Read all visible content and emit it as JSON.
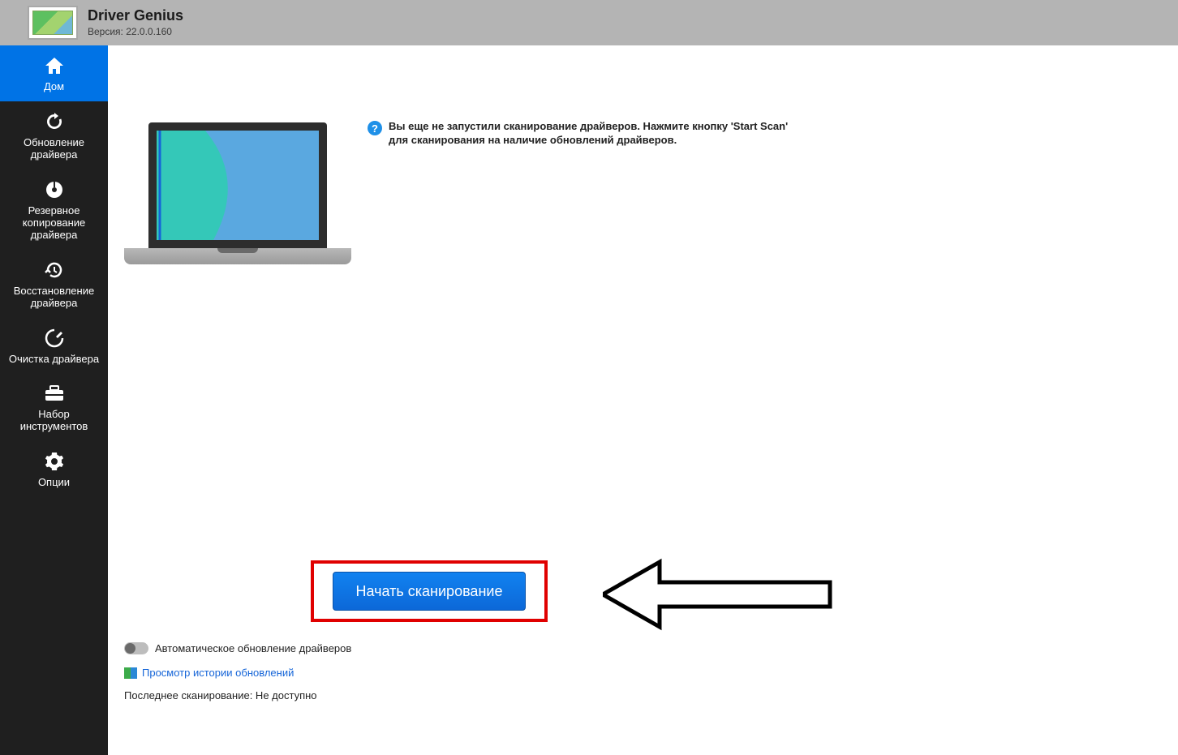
{
  "header": {
    "title": "Driver Genius",
    "version": "Версия: 22.0.0.160"
  },
  "sidebar": [
    {
      "label": "Дом",
      "icon": "home",
      "active": true
    },
    {
      "label": "Обновление драйвера",
      "icon": "refresh",
      "active": false
    },
    {
      "label": "Резервное копирование драйвера",
      "icon": "disc",
      "active": false
    },
    {
      "label": "Восстановление драйвера",
      "icon": "restore",
      "active": false
    },
    {
      "label": "Очистка драйвера",
      "icon": "clean",
      "active": false
    },
    {
      "label": "Набор инструментов",
      "icon": "toolbox",
      "active": false
    },
    {
      "label": "Опции",
      "icon": "gear",
      "active": false
    }
  ],
  "info_text": "Вы еще не запустили сканирование драйверов. Нажмите кнопку 'Start Scan' для сканирования на наличие обновлений драйверов.",
  "scan_button_label": "Начать  сканирование",
  "toggle_label": "Автоматическое обновление драйверов",
  "history_link_label": "Просмотр истории обновлений",
  "last_scan_text": "Последнее сканирование: Не доступно"
}
